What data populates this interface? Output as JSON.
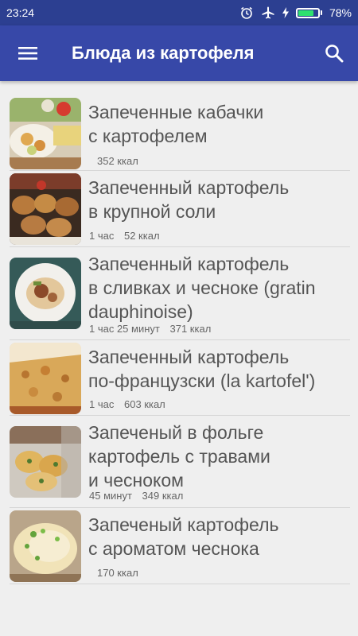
{
  "status": {
    "time": "23:24",
    "battery_percent": "78%",
    "battery_level": 0.78,
    "battery_color": "#2ee06f",
    "icons": [
      "alarm-icon",
      "airplane-mode-icon",
      "charging-icon",
      "battery-icon"
    ]
  },
  "appbar": {
    "menu_icon": "hamburger-menu-icon",
    "title": "Блюда из картофеля",
    "search_icon": "search-icon",
    "color": "#3748a8"
  },
  "recipes": [
    {
      "line1": "Запеченные кабачки",
      "line2": "с картофелем",
      "line3": "",
      "time": "",
      "kcal": "352 ккал"
    },
    {
      "line1": "Запеченный картофель",
      "line2": "в крупной соли",
      "line3": "",
      "time": "1 час",
      "kcal": "52 ккал"
    },
    {
      "line1": "Запеченный картофель",
      "line2": "в сливках и чесноке (gratin",
      "line3": "dauphinoise)",
      "time": "1 час 25 минут",
      "kcal": "371 ккал"
    },
    {
      "line1": "Запеченный картофель",
      "line2": "по-французски (la kartofel')",
      "line3": "",
      "time": "1 час",
      "kcal": "603 ккал"
    },
    {
      "line1": "Запеченый в фольге",
      "line2": "картофель с травами",
      "line3": "и чесноком",
      "time": "45 минут",
      "kcal": "349 ккал"
    },
    {
      "line1": "Запеченый картофель",
      "line2": "с ароматом чеснока",
      "line3": "",
      "time": "",
      "kcal": "170 ккал"
    }
  ]
}
